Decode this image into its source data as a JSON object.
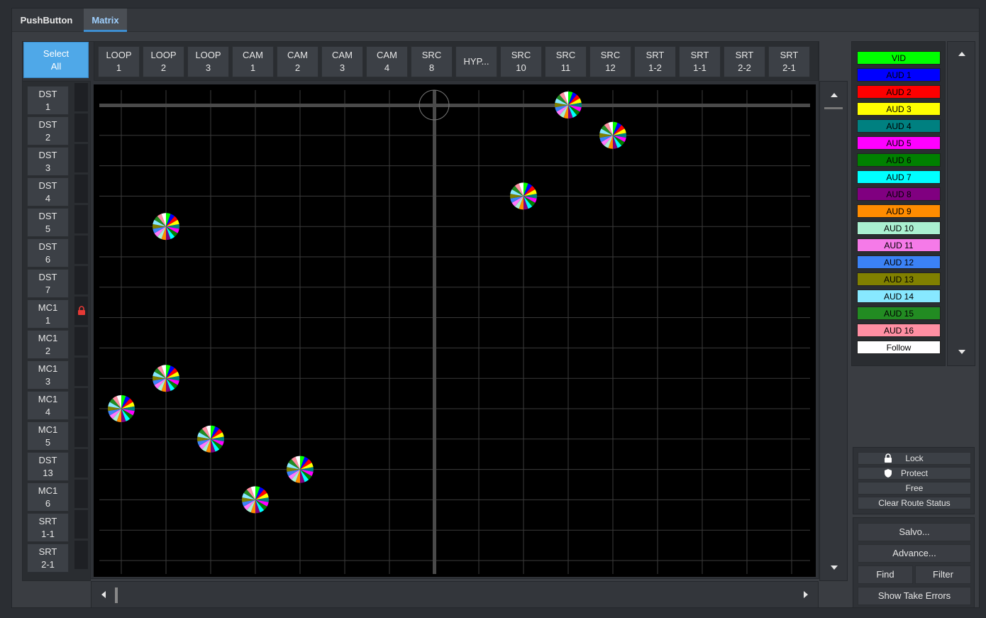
{
  "tabs": [
    {
      "label": "PushButton",
      "active": false
    },
    {
      "label": "Matrix",
      "active": true
    }
  ],
  "select_all": {
    "line1": "Select",
    "line2": "All"
  },
  "sources": [
    {
      "line1": "LOOP",
      "line2": "1"
    },
    {
      "line1": "LOOP",
      "line2": "2"
    },
    {
      "line1": "LOOP",
      "line2": "3"
    },
    {
      "line1": "CAM",
      "line2": "1"
    },
    {
      "line1": "CAM",
      "line2": "2"
    },
    {
      "line1": "CAM",
      "line2": "3"
    },
    {
      "line1": "CAM",
      "line2": "4"
    },
    {
      "line1": "SRC",
      "line2": "8"
    },
    {
      "line1": "HYP...",
      "line2": ""
    },
    {
      "line1": "SRC",
      "line2": "10"
    },
    {
      "line1": "SRC",
      "line2": "11"
    },
    {
      "line1": "SRC",
      "line2": "12"
    },
    {
      "line1": "SRT",
      "line2": "1-2"
    },
    {
      "line1": "SRT",
      "line2": "1-1"
    },
    {
      "line1": "SRT",
      "line2": "2-2"
    },
    {
      "line1": "SRT",
      "line2": "2-1"
    }
  ],
  "destinations": [
    {
      "line1": "DST",
      "line2": "1",
      "locked": false
    },
    {
      "line1": "DST",
      "line2": "2",
      "locked": false
    },
    {
      "line1": "DST",
      "line2": "3",
      "locked": false
    },
    {
      "line1": "DST",
      "line2": "4",
      "locked": false
    },
    {
      "line1": "DST",
      "line2": "5",
      "locked": false
    },
    {
      "line1": "DST",
      "line2": "6",
      "locked": false
    },
    {
      "line1": "DST",
      "line2": "7",
      "locked": false
    },
    {
      "line1": "MC1",
      "line2": "1",
      "locked": true
    },
    {
      "line1": "MC1",
      "line2": "2",
      "locked": false
    },
    {
      "line1": "MC1",
      "line2": "3",
      "locked": false
    },
    {
      "line1": "MC1",
      "line2": "4",
      "locked": false
    },
    {
      "line1": "MC1",
      "line2": "5",
      "locked": false
    },
    {
      "line1": "DST",
      "line2": "13",
      "locked": false
    },
    {
      "line1": "MC1",
      "line2": "6",
      "locked": false
    },
    {
      "line1": "SRT",
      "line2": "1-1",
      "locked": false
    },
    {
      "line1": "SRT",
      "line2": "2-1",
      "locked": false
    }
  ],
  "crosspoints": [
    {
      "src": 10,
      "dst": 0
    },
    {
      "src": 11,
      "dst": 1
    },
    {
      "src": 9,
      "dst": 3
    },
    {
      "src": 1,
      "dst": 4
    },
    {
      "src": 1,
      "dst": 9
    },
    {
      "src": 0,
      "dst": 10
    },
    {
      "src": 2,
      "dst": 11
    },
    {
      "src": 4,
      "dst": 12
    },
    {
      "src": 3,
      "dst": 13
    }
  ],
  "cursor": {
    "src": 7,
    "dst": 0
  },
  "pie_colors": [
    "#00ff00",
    "#0000ff",
    "#ff0000",
    "#ffff00",
    "#008080",
    "#ff00ff",
    "#008000",
    "#00ffff",
    "#800080",
    "#ff8c00",
    "#aaf0d1",
    "#ff77ff",
    "#3b82f6",
    "#808000",
    "#87e8ff",
    "#228b22",
    "#ff8fa3",
    "#ffffff"
  ],
  "levels": [
    {
      "label": "VID",
      "color": "#00ff00",
      "text": "#000000"
    },
    {
      "label": "AUD 1",
      "color": "#0000ff",
      "text": "#000000"
    },
    {
      "label": "AUD 2",
      "color": "#ff0000",
      "text": "#000000"
    },
    {
      "label": "AUD 3",
      "color": "#ffff00",
      "text": "#000000"
    },
    {
      "label": "AUD 4",
      "color": "#008080",
      "text": "#000000"
    },
    {
      "label": "AUD 5",
      "color": "#ff00ff",
      "text": "#000000"
    },
    {
      "label": "AUD 6",
      "color": "#008000",
      "text": "#000000"
    },
    {
      "label": "AUD 7",
      "color": "#00ffff",
      "text": "#000000"
    },
    {
      "label": "AUD 8",
      "color": "#800080",
      "text": "#000000"
    },
    {
      "label": "AUD 9",
      "color": "#ff8c00",
      "text": "#000000"
    },
    {
      "label": "AUD 10",
      "color": "#aaf0d1",
      "text": "#000000"
    },
    {
      "label": "AUD 11",
      "color": "#f57ae8",
      "text": "#000000"
    },
    {
      "label": "AUD 12",
      "color": "#3b82f6",
      "text": "#000000"
    },
    {
      "label": "AUD 13",
      "color": "#808000",
      "text": "#000000"
    },
    {
      "label": "AUD 14",
      "color": "#87e8ff",
      "text": "#000000"
    },
    {
      "label": "AUD 15",
      "color": "#228b22",
      "text": "#000000"
    },
    {
      "label": "AUD 16",
      "color": "#ff8fa3",
      "text": "#000000"
    },
    {
      "label": "Follow",
      "color": "#ffffff",
      "text": "#000000"
    }
  ],
  "status_buttons": {
    "lock": "Lock",
    "protect": "Protect",
    "free": "Free",
    "clear": "Clear Route Status"
  },
  "action_buttons": {
    "salvo": "Salvo...",
    "advance": "Advance...",
    "find": "Find",
    "filter": "Filter",
    "show_take_errors": "Show Take Errors"
  },
  "colors": {
    "accent": "#4fa8e8",
    "lock": "#e53935"
  }
}
